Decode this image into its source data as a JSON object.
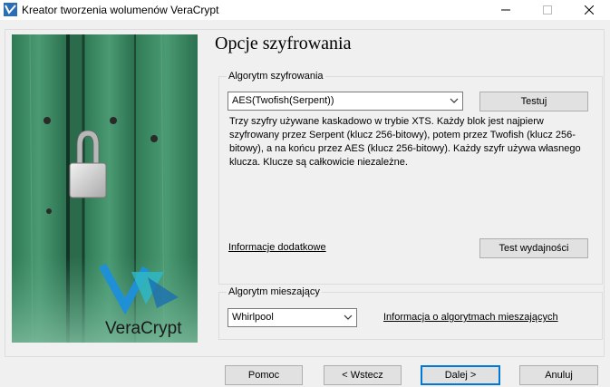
{
  "window": {
    "title": "Kreator tworzenia wolumenów VeraCrypt"
  },
  "banner": {
    "brand_text": "VeraCrypt"
  },
  "page": {
    "title": "Opcje szyfrowania"
  },
  "encryption": {
    "group_label": "Algorytm szyfrowania",
    "selected_algorithm": "AES(Twofish(Serpent))",
    "test_button": "Testuj",
    "description": "Trzy szyfry używane kaskadowo w trybie XTS. Każdy blok jest najpierw szyfrowany przez Serpent (klucz 256-bitowy), potem przez Twofish (klucz 256-bitowy), a na końcu przez AES (klucz 256-bitowy). Każdy szyfr używa własnego klucza. Klucze są całkowicie niezależne.",
    "more_info_link": "Informacje dodatkowe",
    "benchmark_button": "Test wydajności"
  },
  "hash": {
    "group_label": "Algorytm mieszający",
    "selected_algorithm": "Whirlpool",
    "info_link": "Informacja o algorytmach mieszających"
  },
  "footer": {
    "help_button": "Pomoc",
    "back_button": "< Wstecz",
    "next_button": "Dalej >",
    "cancel_button": "Anuluj"
  }
}
